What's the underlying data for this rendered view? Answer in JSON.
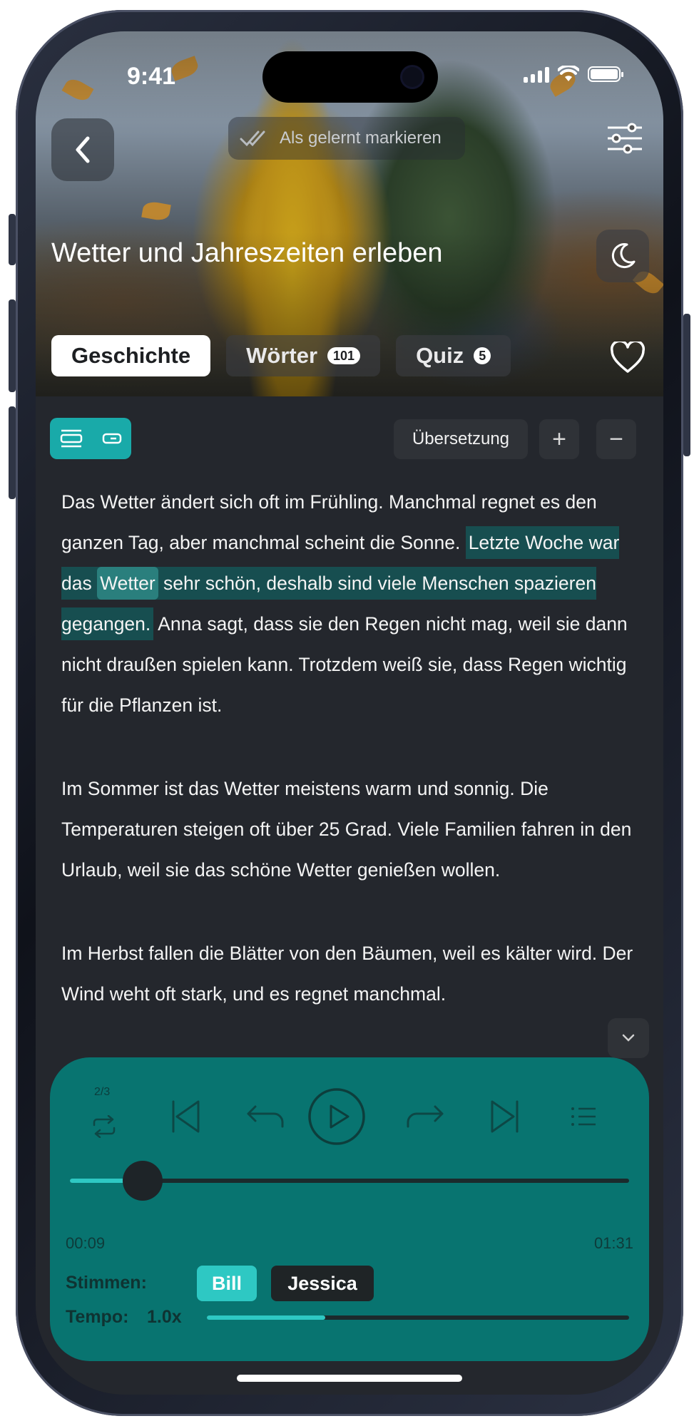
{
  "status": {
    "time": "9:41"
  },
  "header": {
    "back_icon": "chevron-left-icon",
    "mark_learned_label": "Als gelernt markieren",
    "title": "Wetter und Jahreszeiten erleben"
  },
  "tabs": [
    {
      "label": "Geschichte",
      "active": true
    },
    {
      "label": "Wörter",
      "count": "101"
    },
    {
      "label": "Quiz",
      "count": "5"
    }
  ],
  "toolbar": {
    "translation_label": "Übersetzung",
    "plus_label": "+",
    "minus_label": "−"
  },
  "story": {
    "p1_a": "Das Wetter ändert sich oft im Frühling. Manchmal regnet es den ganzen Tag, aber manchmal scheint die Sonne. ",
    "p1_hl_a": "Letzte Woche war das ",
    "p1_hl_word": "Wetter",
    "p1_hl_b": " sehr schön, deshalb sind viele Menschen spazieren gegangen.",
    "p1_b": " Anna sagt, dass sie den Regen nicht mag, weil sie dann nicht draußen spielen kann. Trotzdem weiß sie, dass Regen wichtig für die Pflanzen ist.",
    "p2": "Im Sommer ist das Wetter meistens warm und sonnig. Die Temperaturen steigen oft über 25 Grad. Viele Familien fahren in den Urlaub, weil sie das schöne Wetter genießen wollen.",
    "p3": "Im Herbst fallen die Blätter von den Bäumen, weil es kälter wird. Der Wind weht oft stark, und es regnet manchmal."
  },
  "player": {
    "repeat_count": "2/3",
    "progress": 0.13,
    "current_time": "00:09",
    "total_time": "01:31",
    "voices_label": "Stimmen:",
    "voices": [
      {
        "name": "Bill",
        "selected": true
      },
      {
        "name": "Jessica",
        "selected": false
      }
    ],
    "tempo_label": "Tempo:",
    "tempo_value": "1.0x",
    "tempo_fraction": 0.28
  },
  "colors": {
    "accent": "#19aaa9",
    "player_bg": "#087470",
    "highlight": "#174e50",
    "background": "#24272d"
  }
}
